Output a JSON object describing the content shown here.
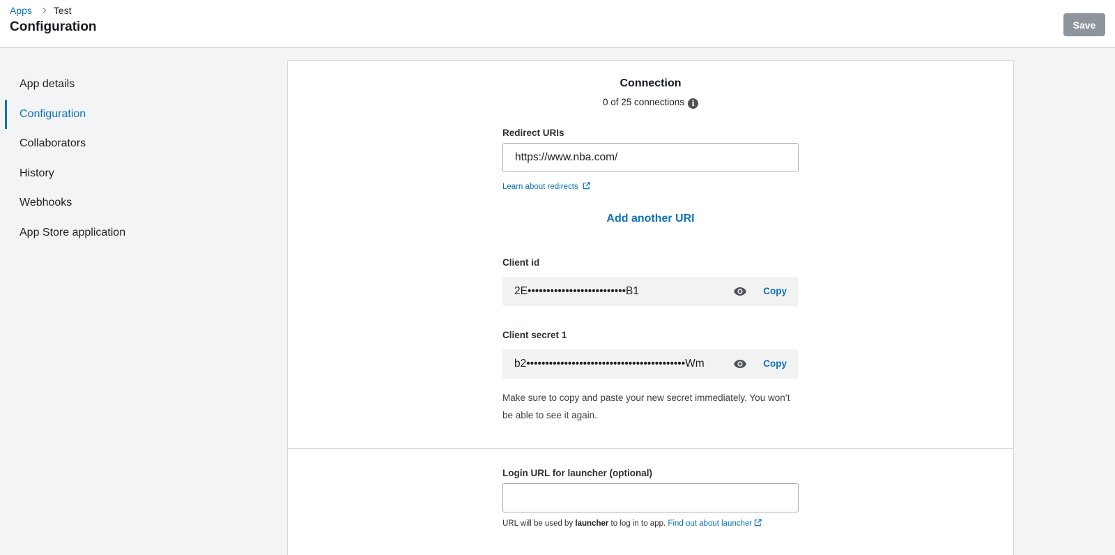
{
  "header": {
    "breadcrumb": {
      "root": "Apps",
      "current": "Test"
    },
    "title": "Configuration",
    "save_label": "Save"
  },
  "sidebar": {
    "items": [
      {
        "label": "App details",
        "active": false
      },
      {
        "label": "Configuration",
        "active": true
      },
      {
        "label": "Collaborators",
        "active": false
      },
      {
        "label": "History",
        "active": false
      },
      {
        "label": "Webhooks",
        "active": false
      },
      {
        "label": "App Store application",
        "active": false
      }
    ]
  },
  "connection": {
    "title": "Connection",
    "count_text": "0 of 25 connections",
    "redirect_label": "Redirect URIs",
    "redirect_value": "https://www.nba.com/",
    "learn_link": "Learn about redirects",
    "add_uri": "Add another URI",
    "client_id_label": "Client id",
    "client_id_value": "2E••••••••••••••••••••••••••B1",
    "client_secret_label": "Client secret 1",
    "client_secret_value": "b2••••••••••••••••••••••••••••••••••••••••••Wm",
    "copy_label": "Copy",
    "secret_note": "Make sure to copy and paste your new secret immediately. You won’t be able to see it again."
  },
  "launcher": {
    "label": "Login URL for launcher (optional)",
    "value": "",
    "help_prefix": "URL will be used by ",
    "help_bold": "launcher",
    "help_suffix": " to log in to app. ",
    "help_link": "Find out about launcher"
  },
  "colors": {
    "accent": "#0b74b8",
    "save_disabled": "#8e959c",
    "page_bg": "#f3f4f5"
  },
  "icons": [
    "chevron-right-icon",
    "info-icon",
    "external-link-icon",
    "eye-icon"
  ]
}
